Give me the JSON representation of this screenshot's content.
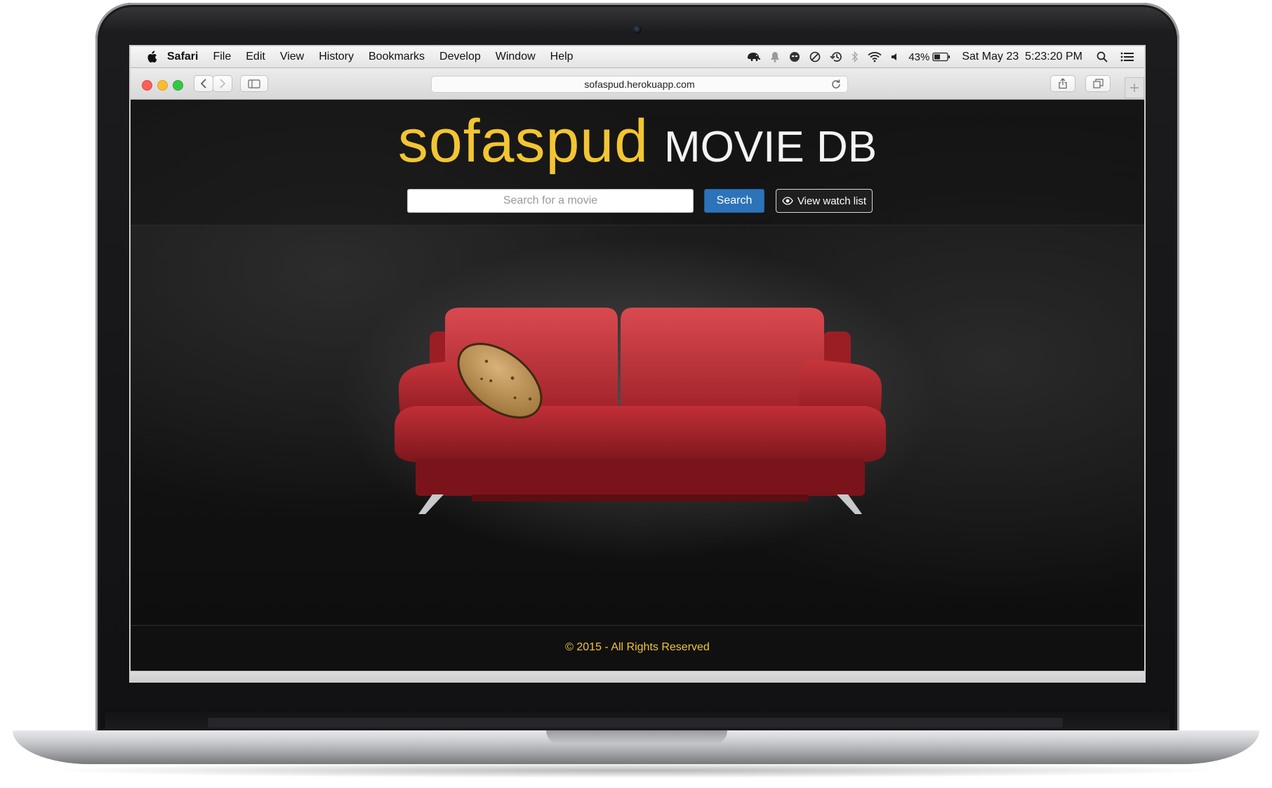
{
  "menubar": {
    "app_name": "Safari",
    "items": [
      "File",
      "Edit",
      "View",
      "History",
      "Bookmarks",
      "Develop",
      "Window",
      "Help"
    ],
    "battery_percent": "43%",
    "clock": "Sat May 23  5:23:20 PM"
  },
  "browser": {
    "url": "sofaspud.herokuapp.com"
  },
  "site": {
    "brand_primary": "sofaspud",
    "brand_secondary": "MOVIE DB",
    "search_placeholder": "Search for a movie",
    "search_button": "Search",
    "watchlist_button": "View watch list",
    "footer": "© 2015 - All Rights Reserved"
  },
  "colors": {
    "brand_yellow": "#f2c532",
    "button_blue": "#2c73ba",
    "sofa_red": "#b3212a",
    "potato": "#b58a4c"
  },
  "icons": {
    "apple": "apple-icon",
    "watchlist": "eye-icon",
    "back": "chevron-left-icon",
    "forward": "chevron-right-icon"
  }
}
